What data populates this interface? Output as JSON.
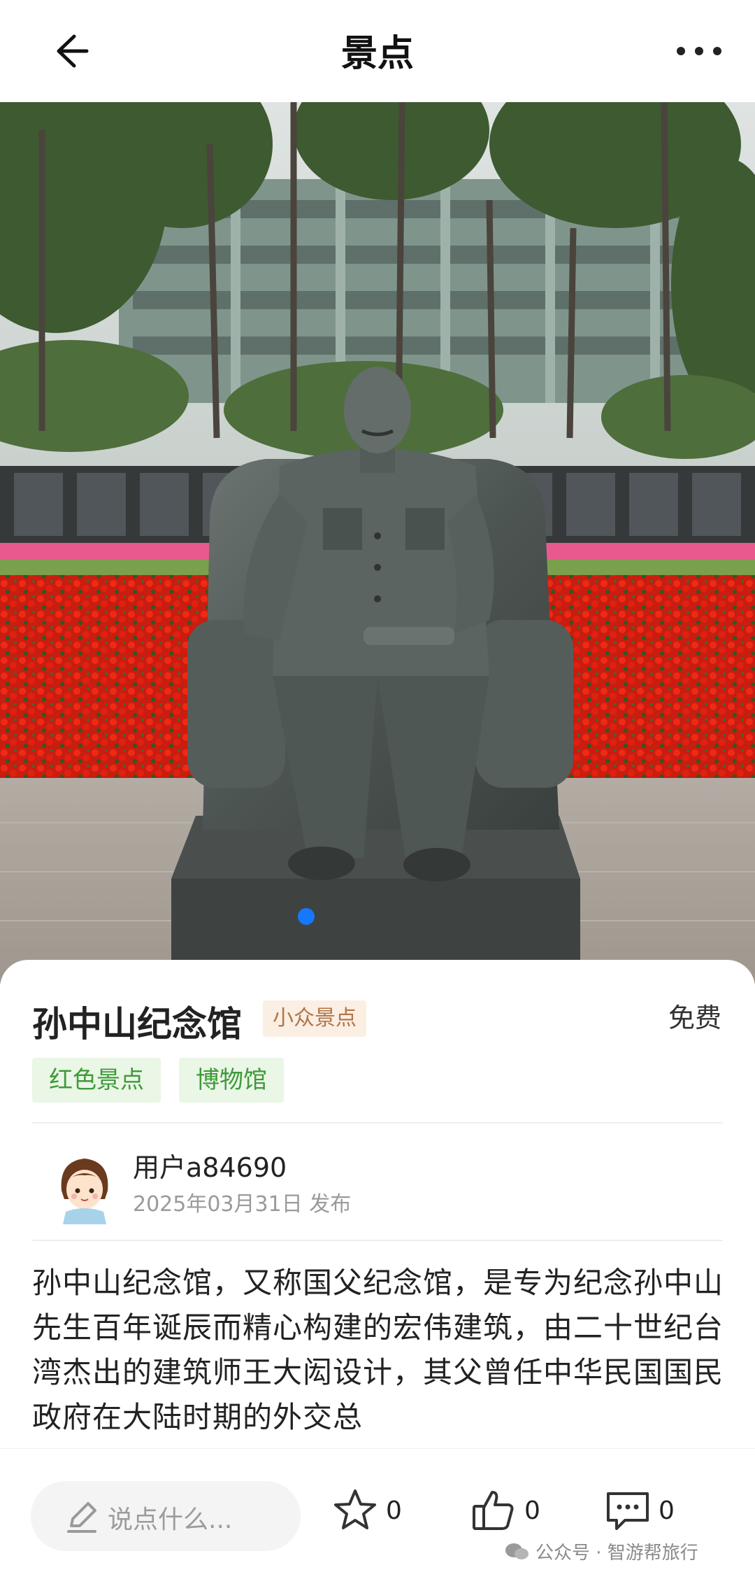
{
  "header": {
    "title": "景点"
  },
  "spot": {
    "name": "孙中山纪念馆",
    "niche_tag": "小众景点",
    "price": "免费",
    "categories": [
      "红色景点",
      "博物馆"
    ]
  },
  "post": {
    "author": "用户a84690",
    "date": "2025年03月31日 发布",
    "description": "孙中山纪念馆，又称国父纪念馆，是专为纪念孙中山先生百年诞辰而精心构建的宏伟建筑，由二十世纪台湾杰出的建筑师王大闳设计，其父曾任中华民国国民政府在大陆时期的外交总"
  },
  "bottom_bar": {
    "comment_placeholder": "说点什么...",
    "favorites": "0",
    "likes": "0",
    "comments": "0"
  },
  "watermark": "公众号 · 智游帮旅行",
  "icons": {
    "back": "arrow-left-icon",
    "more": "more-dots-icon",
    "pen": "pen-icon",
    "favorite": "star-outline-icon",
    "like": "thumbs-up-icon",
    "comment": "comment-bubble-icon"
  },
  "colors": {
    "niche_tag_bg": "#fbeee3",
    "niche_tag_text": "#b07548",
    "category_bg": "#eaf6e6",
    "category_text": "#3f9a3a",
    "page_dot": "#1677ff"
  }
}
